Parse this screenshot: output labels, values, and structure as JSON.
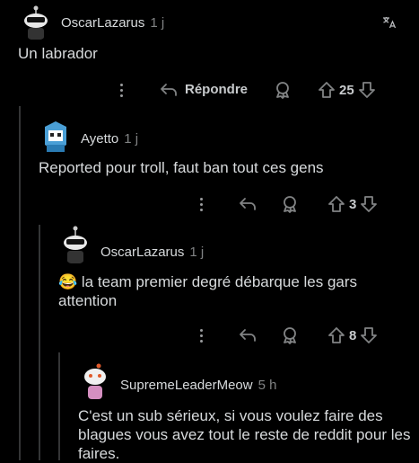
{
  "comments": [
    {
      "author": "OscarLazarus",
      "time": "1 j",
      "text": "Un labrador",
      "votes": "25",
      "reply_label": "Répondre"
    },
    {
      "author": "Ayetto",
      "time": "1 j",
      "text": "Reported pour troll, faut ban tout ces gens",
      "votes": "3"
    },
    {
      "author": "OscarLazarus",
      "time": "1 j",
      "emoji": "😂",
      "text": "la team premier degré débarque les gars attention",
      "votes": "8"
    },
    {
      "author": "SupremeLeaderMeow",
      "time": "5 h",
      "text": "C'est un sub sérieux, si vous voulez faire des blagues vous avez tout le reste de reddit pour les faires."
    }
  ],
  "icons": [
    "translate-icon",
    "more-icon",
    "reply-icon",
    "award-icon",
    "upvote-icon",
    "downvote-icon"
  ]
}
